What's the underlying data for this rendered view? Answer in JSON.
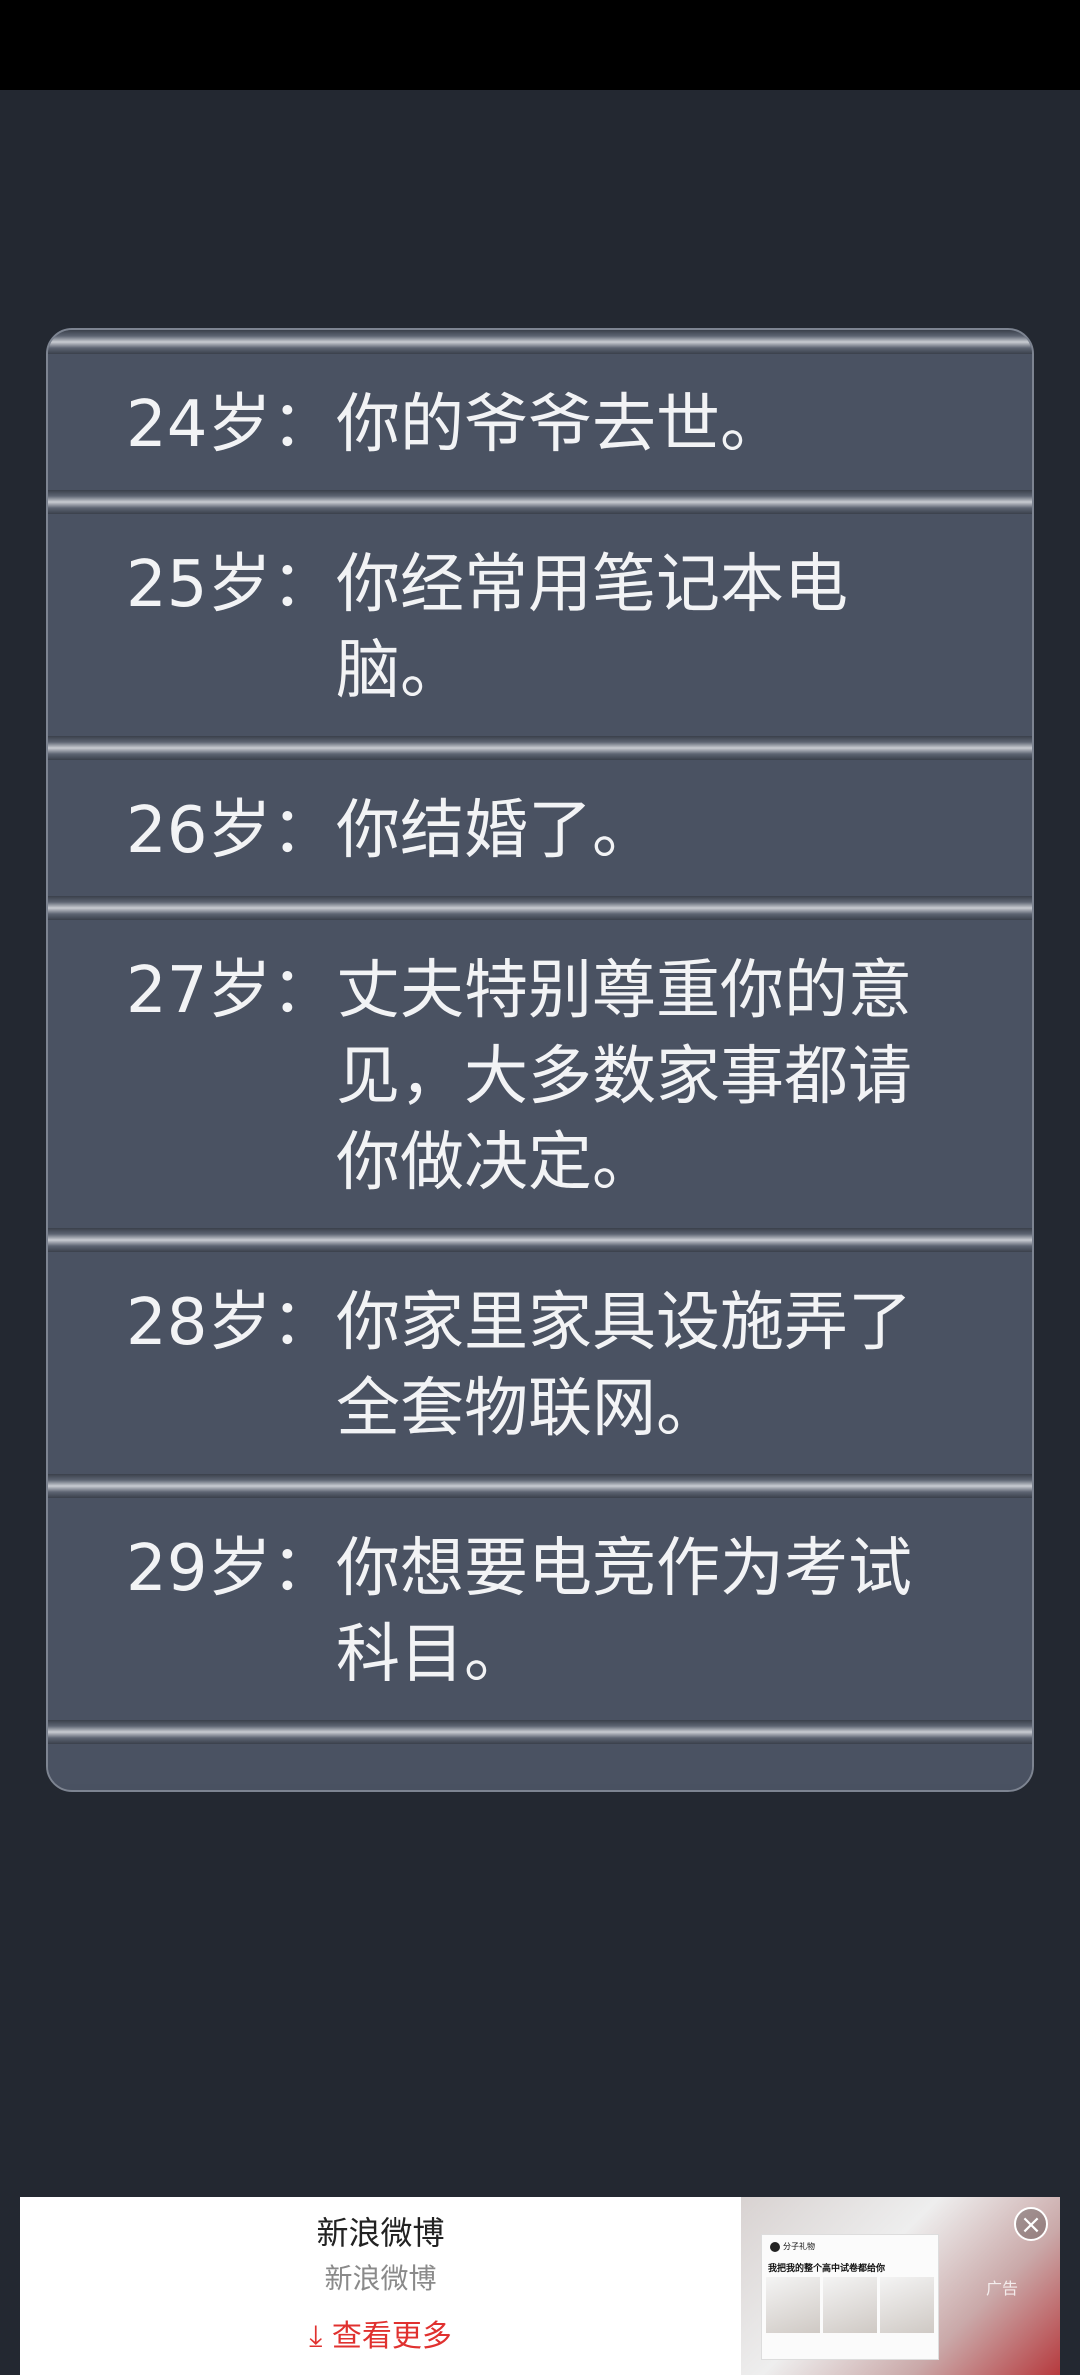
{
  "timeline": [
    {
      "age": "24岁：",
      "text": "你的爷爷去世。"
    },
    {
      "age": "25岁：",
      "text": "你经常用笔记本电脑。"
    },
    {
      "age": "26岁：",
      "text": "你结婚了。"
    },
    {
      "age": "27岁：",
      "text": "丈夫特别尊重你的意见，大多数家事都请你做决定。"
    },
    {
      "age": "28岁：",
      "text": "你家里家具设施弄了全套物联网。"
    },
    {
      "age": "29岁：",
      "text": "你想要电竞作为考试科目。"
    }
  ],
  "ad": {
    "title": "新浪微博",
    "subtitle": "新浪微博",
    "more_label": "查看更多",
    "more_icon": "download-arrow-icon",
    "card_author": "分子礼物",
    "card_caption": "我把我的整个高中试卷都给你",
    "close_icon": "close-icon",
    "corner_label": "广告",
    "accent_color": "#e0312f"
  }
}
